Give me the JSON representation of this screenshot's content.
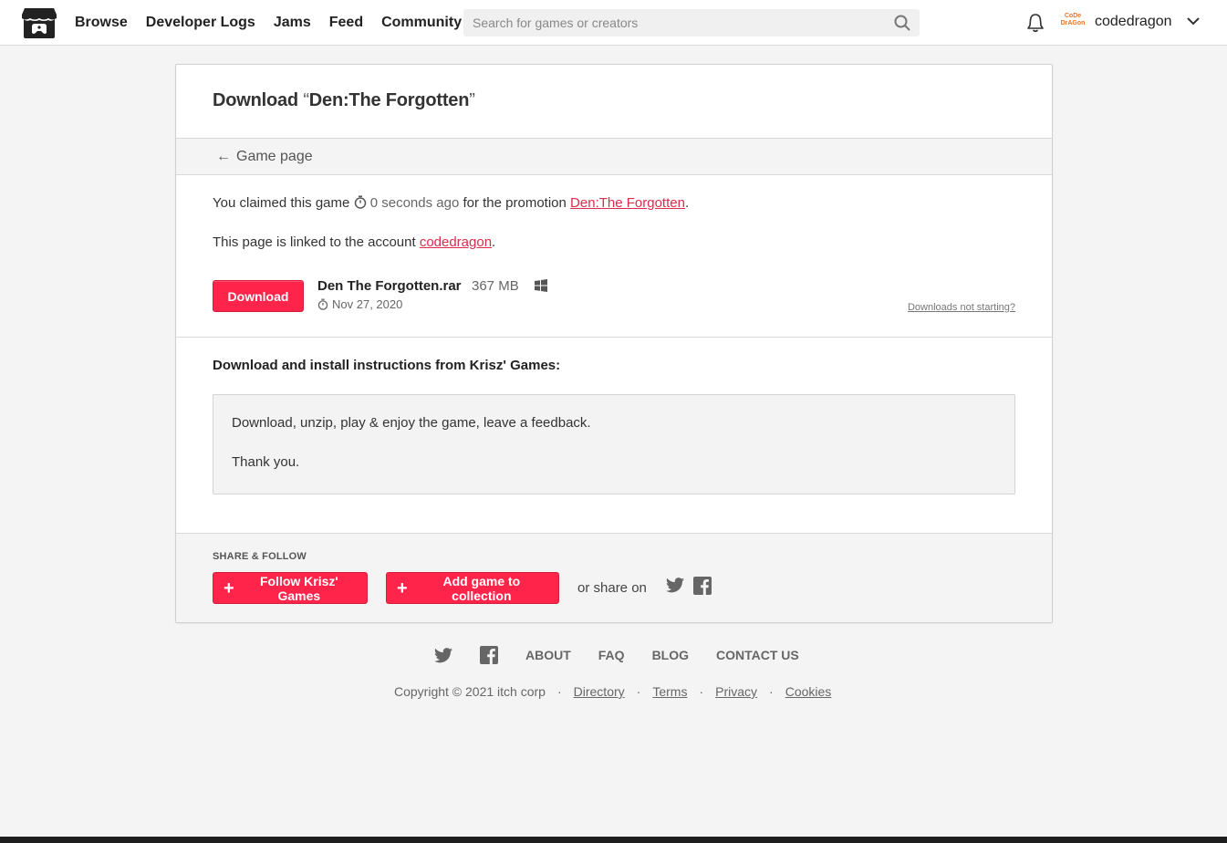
{
  "header": {
    "nav": [
      "Browse",
      "Developer Logs",
      "Jams",
      "Feed",
      "Community"
    ],
    "search_placeholder": "Search for games or creators",
    "avatar_text": "CoDe DrAGon",
    "username": "codedragon"
  },
  "page": {
    "title_prefix": "Download",
    "open_quote": "“",
    "game_title": "Den:The Forgotten",
    "close_quote": "”",
    "back_label": "Game page",
    "claim_text_1": "You claimed this game",
    "claim_time": "0 seconds ago",
    "claim_text_2": "for the promotion",
    "promotion_link": "Den:The Forgotten",
    "linked_text": "This page is linked to the account",
    "account_link": "codedragon",
    "download_label": "Download",
    "file_name": "Den The Forgotten.rar",
    "file_size": "367 MB",
    "file_date": "Nov 27, 2020",
    "not_starting": "Downloads not starting?",
    "instructions_heading": "Download and install instructions from Krisz' Games:",
    "instructions": [
      "Download, unzip, play & enjoy the game, leave a feedback.",
      "Thank you."
    ],
    "share_title": "SHARE & FOLLOW",
    "follow_label": "Follow Krisz' Games",
    "collection_label": "Add game to collection",
    "or_share": "or share on"
  },
  "footer": {
    "links": [
      "ABOUT",
      "FAQ",
      "BLOG",
      "CONTACT US"
    ],
    "copyright": "Copyright © 2021 itch corp",
    "legal": [
      "Directory",
      "Terms",
      "Privacy",
      "Cookies"
    ]
  },
  "colors": {
    "accent": "#ff2449",
    "link": "#da2c4c"
  }
}
